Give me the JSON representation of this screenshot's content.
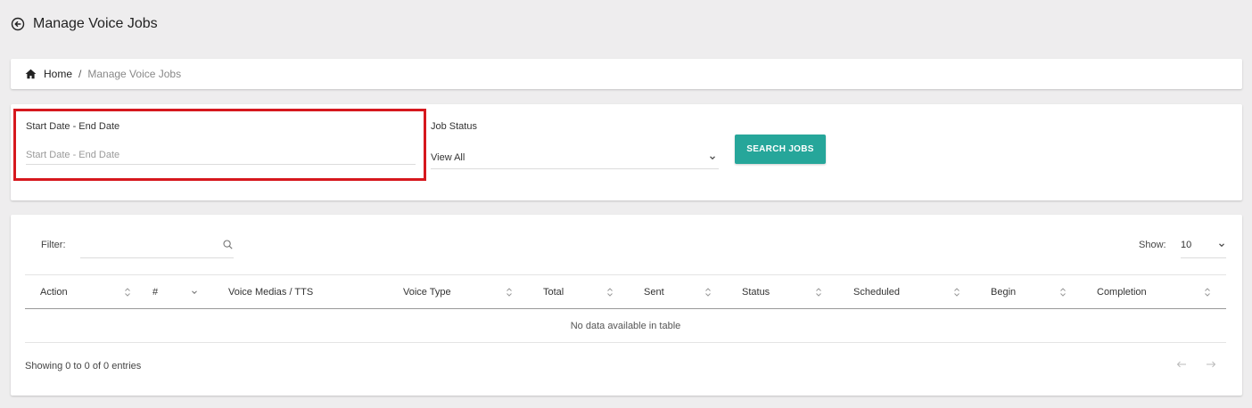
{
  "header": {
    "title": "Manage Voice Jobs",
    "back_icon": "arrow-left-circle-icon"
  },
  "breadcrumb": {
    "home_icon": "home-icon",
    "home": "Home",
    "separator": "/",
    "current": "Manage Voice Jobs"
  },
  "filters": {
    "date_range": {
      "label": "Start Date - End Date",
      "placeholder": "Start Date - End Date",
      "value": ""
    },
    "job_status": {
      "label": "Job Status",
      "selected": "View All"
    },
    "search_button": "SEARCH JOBS"
  },
  "table": {
    "filter_label": "Filter:",
    "filter_value": "",
    "show_label": "Show:",
    "page_size": "10",
    "columns": [
      "Action",
      "#",
      "Voice Medias / TTS",
      "Voice Type",
      "Total",
      "Sent",
      "Status",
      "Scheduled",
      "Begin",
      "Completion"
    ],
    "empty_message": "No data available in table",
    "info": "Showing 0 to 0 of 0 entries",
    "pager": {
      "prev": "←",
      "next": "→"
    }
  },
  "colors": {
    "accent": "#26a69a",
    "highlight": "#d6181e",
    "background": "#eeedee"
  }
}
